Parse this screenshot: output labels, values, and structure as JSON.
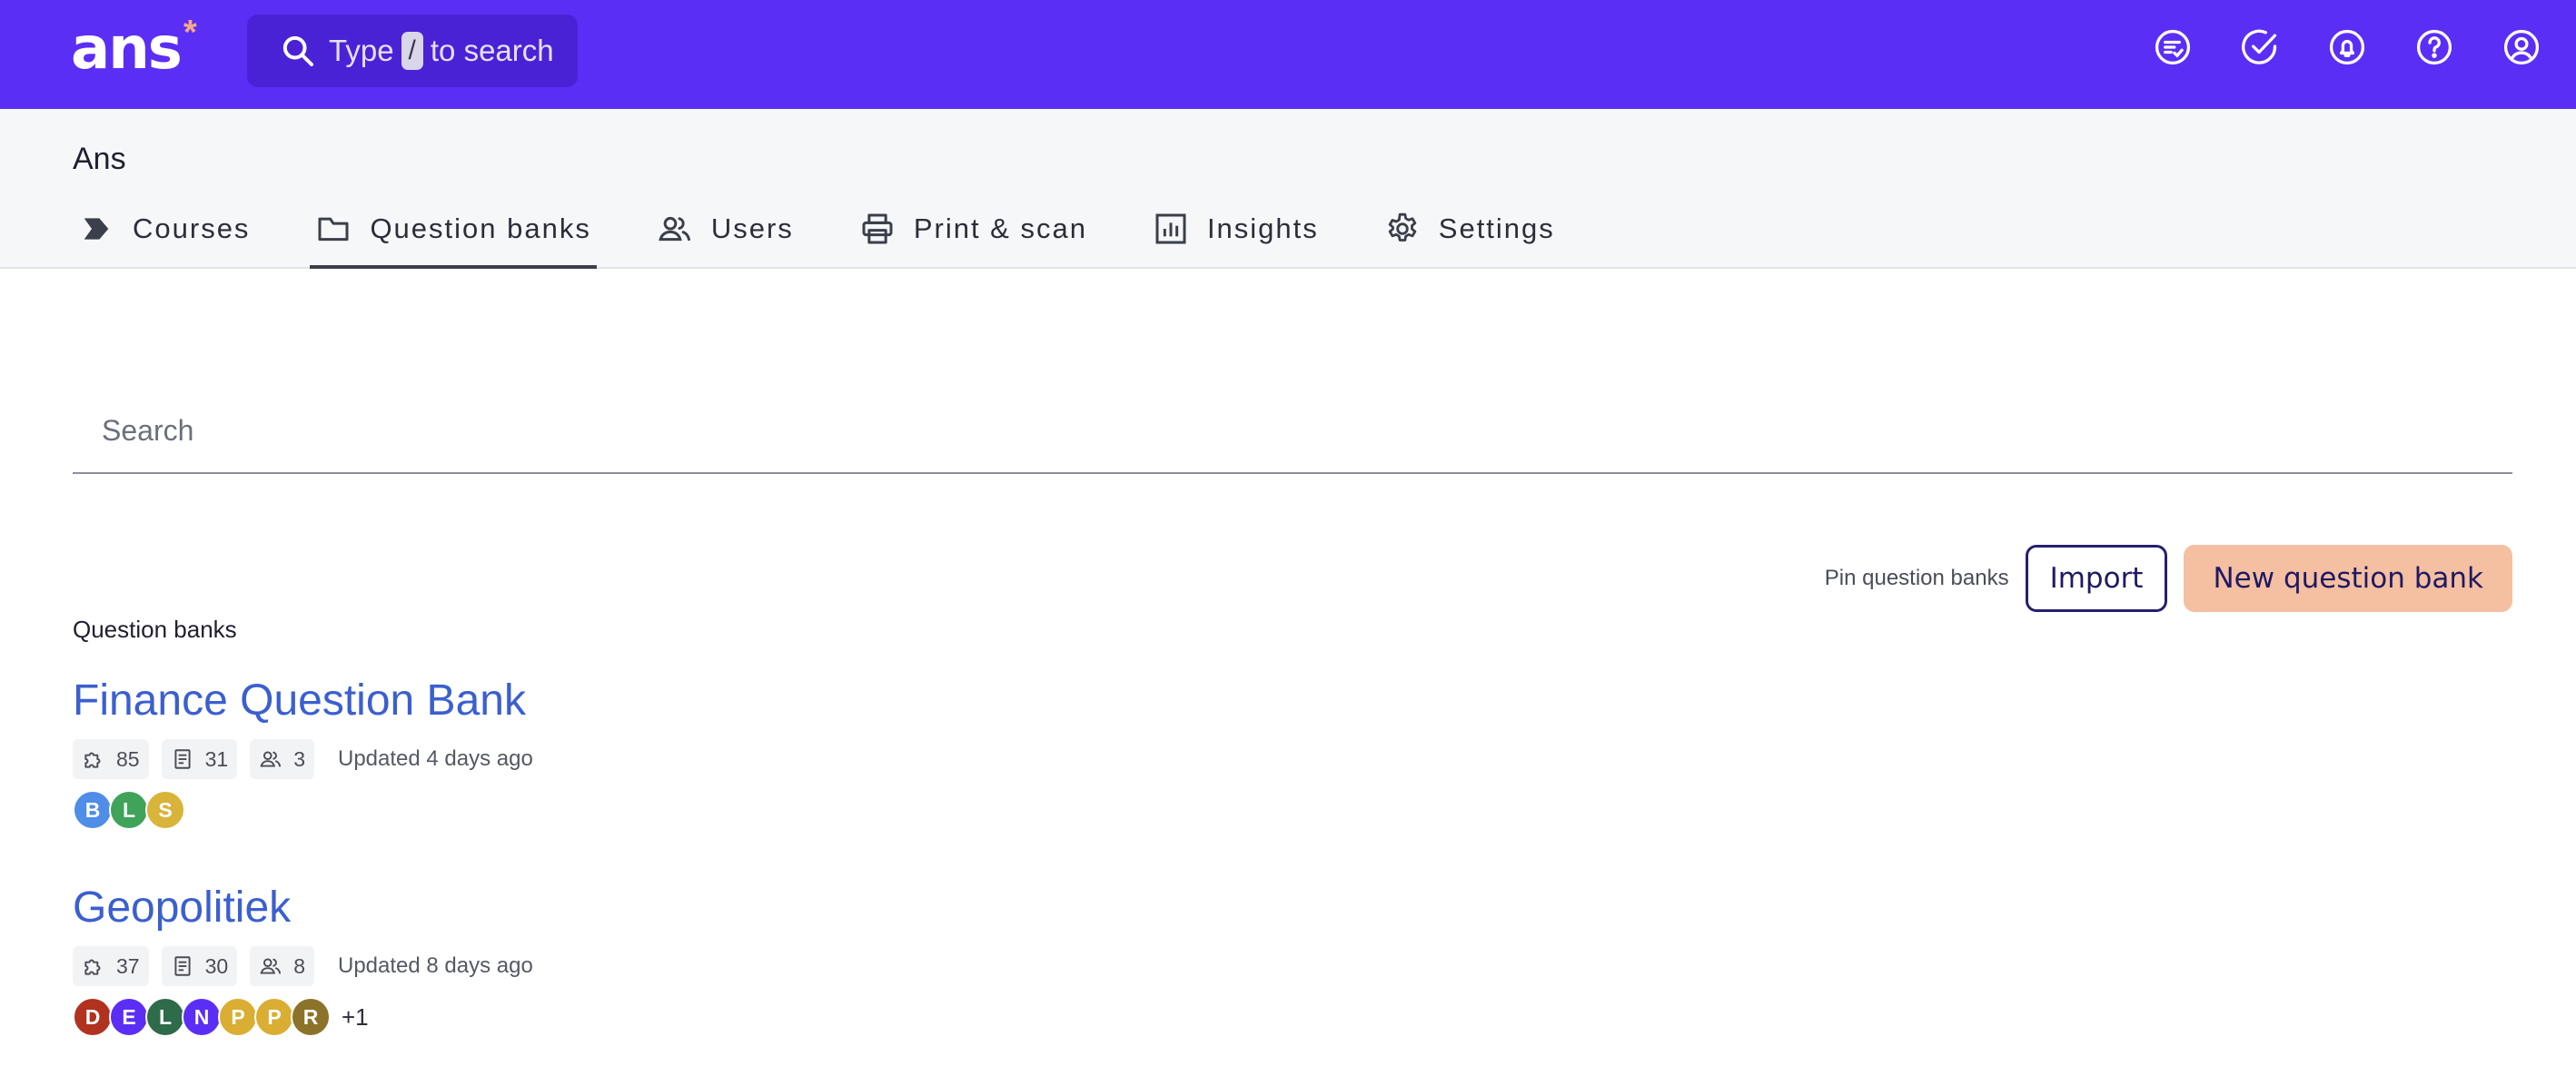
{
  "app": {
    "logo": "ans",
    "logo_star": "*",
    "search_pre": "Type",
    "search_key": "/",
    "search_post": "to search",
    "top_icons": [
      "feedback-icon",
      "check-circle-icon",
      "notifications-icon",
      "help-icon",
      "account-icon"
    ]
  },
  "org": {
    "name": "Ans"
  },
  "tabs": [
    {
      "label": "Courses",
      "icon": "courses-icon"
    },
    {
      "label": "Question banks",
      "icon": "folder-icon",
      "active": true
    },
    {
      "label": "Users",
      "icon": "users-icon"
    },
    {
      "label": "Print & scan",
      "icon": "printer-icon"
    },
    {
      "label": "Insights",
      "icon": "insights-icon"
    },
    {
      "label": "Settings",
      "icon": "gear-icon"
    }
  ],
  "search": {
    "placeholder": "Search"
  },
  "actions": {
    "pin": "Pin question banks",
    "import": "Import",
    "new": "New question bank"
  },
  "section_label": "Question banks",
  "colors": {
    "topbar": "#5b2ef5",
    "link": "#3b5fcf",
    "accent_button": "#f5bfa1"
  },
  "banks": [
    {
      "title": "Finance Question Bank",
      "questions": "85",
      "assignments": "31",
      "members": "3",
      "updated": "Updated 4 days ago",
      "avatars": [
        {
          "letter": "B",
          "color": "#4f8de8"
        },
        {
          "letter": "L",
          "color": "#3fa35a"
        },
        {
          "letter": "S",
          "color": "#d8b43a"
        }
      ],
      "more": ""
    },
    {
      "title": "Geopolitiek",
      "questions": "37",
      "assignments": "30",
      "members": "8",
      "updated": "Updated 8 days ago",
      "avatars": [
        {
          "letter": "D",
          "color": "#b0321f"
        },
        {
          "letter": "E",
          "color": "#5b2ef5"
        },
        {
          "letter": "L",
          "color": "#2e6b4a"
        },
        {
          "letter": "N",
          "color": "#5b2ef5"
        },
        {
          "letter": "P",
          "color": "#d9ae32"
        },
        {
          "letter": "P",
          "color": "#d9ae32"
        },
        {
          "letter": "R",
          "color": "#8c7329"
        }
      ],
      "more": "+1"
    }
  ]
}
